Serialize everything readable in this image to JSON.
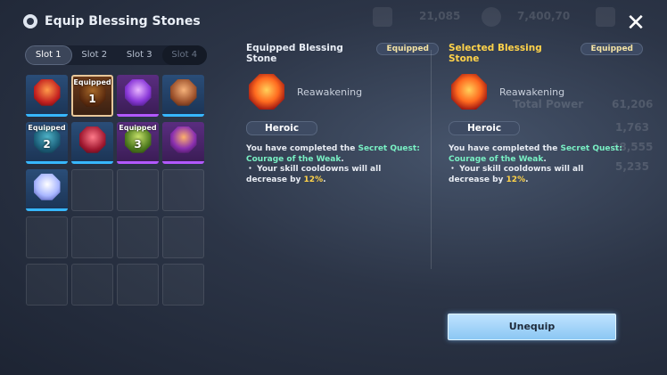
{
  "header": {
    "title": "Equip Blessing Stones"
  },
  "background_text": {
    "value1": "21,085",
    "value2": "7,400,70",
    "label": "Total Power",
    "stat1": "61,206",
    "stat2": "1,763",
    "stat3": "38,555",
    "stat4": "5,235"
  },
  "tabs": [
    {
      "label": "Slot 1",
      "active": true
    },
    {
      "label": "Slot 2"
    },
    {
      "label": "Slot 3"
    },
    {
      "label": "Slot 4",
      "dim": true
    }
  ],
  "grid": {
    "cells": [
      {
        "stone": "red-sword-stone",
        "frame": "blue"
      },
      {
        "stone": "fire-stone",
        "frame": "gold",
        "equipped_label": "Equipped",
        "slot_number": "1"
      },
      {
        "stone": "purple-figure-stone",
        "frame": "purple"
      },
      {
        "stone": "bronze-shield-stone",
        "frame": "blue"
      },
      {
        "stone": "teal-stone",
        "frame": "blue",
        "equipped_label": "Equipped",
        "slot_number": "2"
      },
      {
        "stone": "crimson-dragon-stone",
        "frame": "blue"
      },
      {
        "stone": "green-beast-stone",
        "frame": "purple",
        "equipped_label": "Equipped",
        "slot_number": "3"
      },
      {
        "stone": "violet-dancer-stone",
        "frame": "purple"
      },
      {
        "stone": "white-fox-stone",
        "frame": "blue"
      }
    ],
    "empty_cells": 11
  },
  "equipped_panel": {
    "title": "Equipped Blessing Stone",
    "badge": "Equipped",
    "stone_name": "Reawakening",
    "rarity": "Heroic",
    "desc_prefix": "You have completed the ",
    "quest_label": "Secret Quest:",
    "quest_name": "Courage of the Weak",
    "desc_suffix": ".",
    "effect_prefix": "・ Your skill cooldowns will all decrease by ",
    "effect_value": "12%",
    "effect_suffix": "."
  },
  "selected_panel": {
    "title": "Selected Blessing Stone",
    "badge": "Equipped",
    "stone_name": "Reawakening",
    "rarity": "Heroic",
    "desc_prefix": "You have completed the ",
    "quest_label": "Secret Quest:",
    "quest_name": "Courage of the Weak",
    "desc_suffix": ".",
    "effect_prefix": "・ Your skill cooldowns will all decrease by ",
    "effect_value": "12%",
    "effect_suffix": "."
  },
  "actions": {
    "unequip_label": "Unequip"
  },
  "icons": {
    "close": "close-icon",
    "title": "blessing-stone-icon"
  },
  "colors": {
    "accent_yellow": "#ffd34a",
    "accent_green": "#79f0c4",
    "button": "#a9d7fa"
  }
}
